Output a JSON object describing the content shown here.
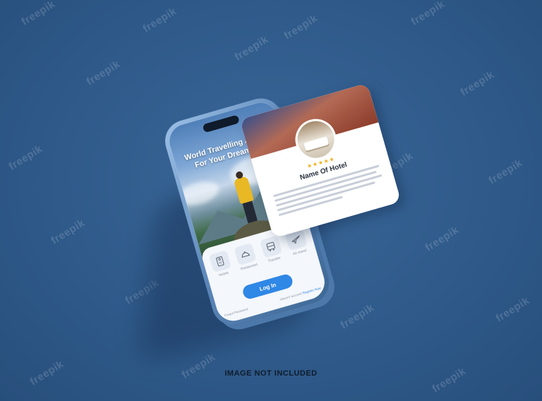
{
  "watermarks": [
    "freepik",
    "freepik",
    "freepik",
    "freepik",
    "freepik",
    "freepik",
    "freepik",
    "freepik",
    "freepik",
    "freepik",
    "freepik",
    "freepik",
    "freepik",
    "freepik",
    "freepik",
    "freepik",
    "freepik",
    "freepik"
  ],
  "phone": {
    "hero_title_line1": "World Travelling Agency",
    "hero_title_line2": "For Your Dream Trip",
    "categories": [
      {
        "label": "Hotels",
        "icon": "hotel-door-tag-icon"
      },
      {
        "label": "Restaurant",
        "icon": "cloche-icon"
      },
      {
        "label": "Transfer",
        "icon": "bus-icon"
      },
      {
        "label": "Air travel",
        "icon": "airplane-icon"
      }
    ],
    "login_label": "Log In",
    "forgot_password": "Forgot Password",
    "no_account": "Haven't account",
    "register_now": "Register Now"
  },
  "hotel_card": {
    "stars": "★★★★★",
    "name": "Name Of Hotel"
  },
  "caption": "IMAGE NOT INCLUDED",
  "colors": {
    "background": "#2f5a8a",
    "accent": "#2f87e6",
    "star": "#f2b01e"
  }
}
